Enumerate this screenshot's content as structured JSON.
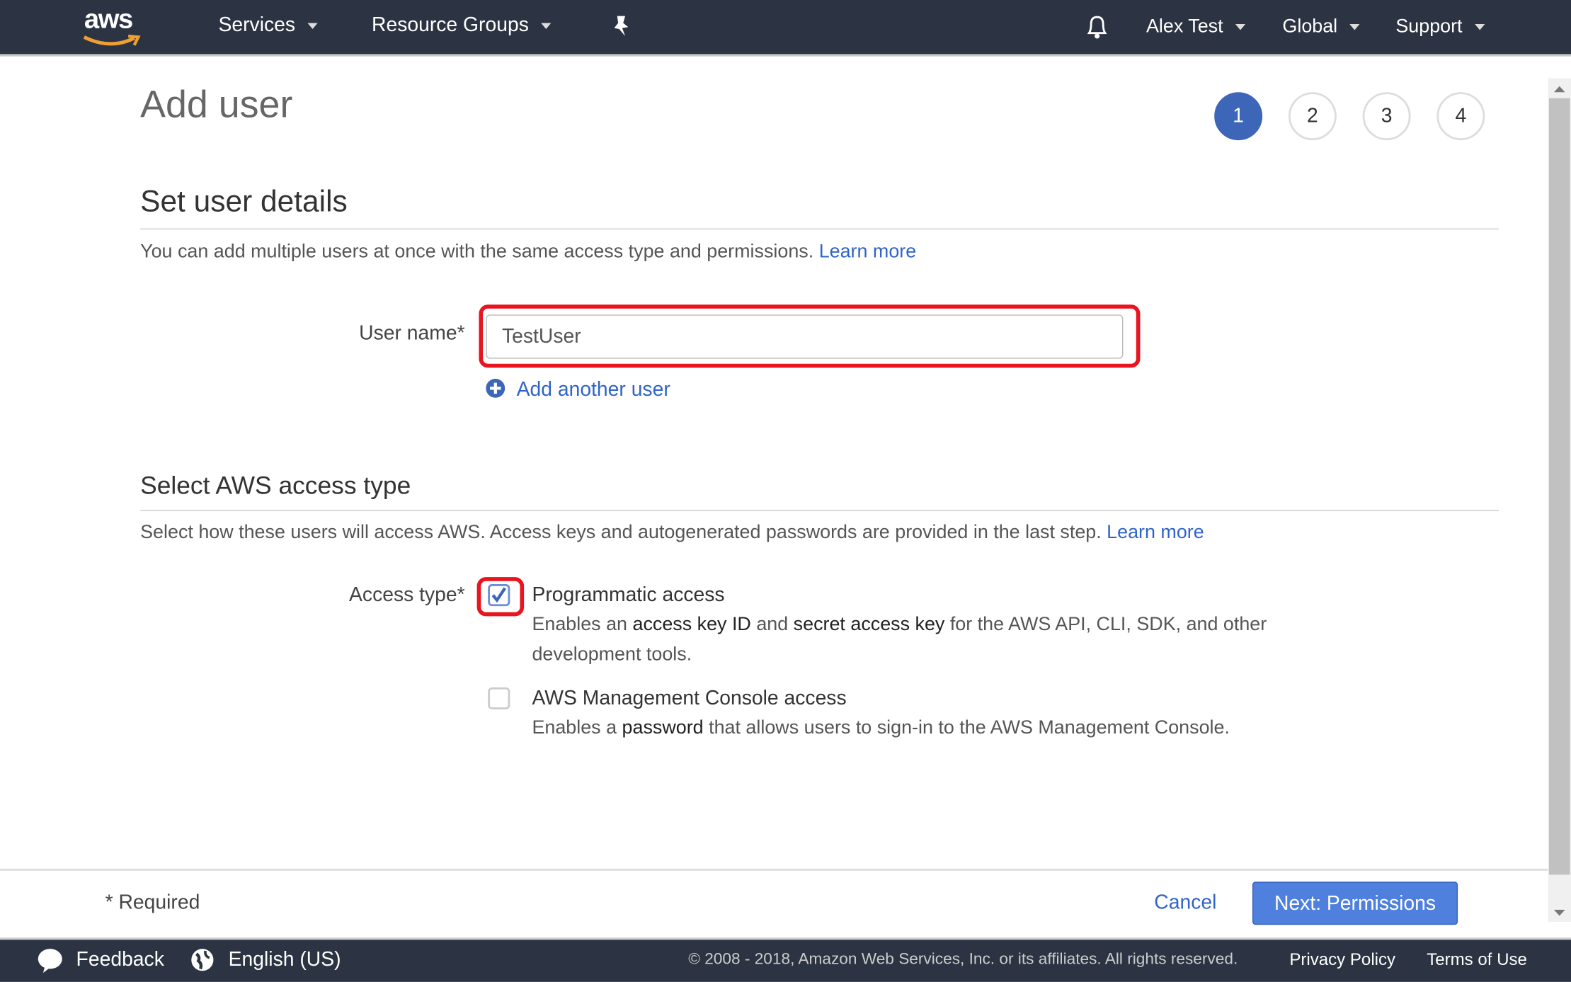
{
  "nav": {
    "logo": "aws",
    "services": "Services",
    "resource_groups": "Resource Groups",
    "user": "Alex Test",
    "region": "Global",
    "support": "Support"
  },
  "page": {
    "title": "Add user",
    "steps": [
      "1",
      "2",
      "3",
      "4"
    ],
    "active_step": 1
  },
  "details": {
    "heading": "Set user details",
    "description": "You can add multiple users at once with the same access type and permissions.",
    "learn_more": "Learn more",
    "username_label": "User name*",
    "username_value": "TestUser",
    "add_another": "Add another user"
  },
  "access": {
    "heading": "Select AWS access type",
    "description": "Select how these users will access AWS. Access keys and autogenerated passwords are provided in the last step.",
    "learn_more": "Learn more",
    "label": "Access type*",
    "programmatic": {
      "title": "Programmatic access",
      "checked": true,
      "d1": "Enables an ",
      "b1": "access key ID",
      "d2": " and ",
      "b2": "secret access key",
      "d3": " for the AWS API, CLI, SDK, and other",
      "d4": "development tools."
    },
    "console": {
      "title": "AWS Management Console access",
      "checked": false,
      "d1": "Enables a ",
      "b1": "password",
      "d2": " that allows users to sign-in to the AWS Management Console."
    }
  },
  "footer": {
    "required": "* Required",
    "cancel": "Cancel",
    "next": "Next: Permissions"
  },
  "bottom": {
    "feedback": "Feedback",
    "language": "English (US)",
    "copyright": "© 2008 - 2018, Amazon Web Services, Inc. or its affiliates. All rights reserved.",
    "privacy": "Privacy Policy",
    "terms": "Terms of Use"
  },
  "colors": {
    "nav_bg": "#2c3342",
    "accent": "#3d66b9",
    "link": "#2f64c9",
    "highlight": "#e8141f"
  }
}
